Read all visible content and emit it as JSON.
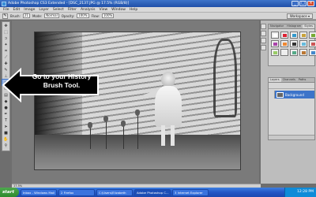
{
  "window": {
    "title": "Adobe Photoshop CS3 Extended - [DSC_2137.JPG @ 17.5% (RGB/8)]",
    "minimize": "_",
    "maximize": "□",
    "close": "×"
  },
  "menu": [
    "File",
    "Edit",
    "Image",
    "Layer",
    "Select",
    "Filter",
    "Analysis",
    "View",
    "Window",
    "Help"
  ],
  "options": {
    "brush_label": "Brush:",
    "brush_size": "21",
    "mode_label": "Mode:",
    "mode_value": "Normal",
    "opacity_label": "Opacity:",
    "opacity_value": "100%",
    "flow_label": "Flow:",
    "flow_value": "100%",
    "workspace": "Workspace ▾"
  },
  "callout": {
    "line1": "Go to your History",
    "line2": "Brush Tool."
  },
  "panels": {
    "swatch_tabs": [
      "Navigator",
      "Histogram",
      "Styles"
    ],
    "layer_tabs": [
      "Layers",
      "Channels",
      "Paths"
    ],
    "layer_name": "Background"
  },
  "status": "17.5%",
  "taskbar": {
    "start": "start",
    "tasks": [
      "Inbox - Windows Mail",
      "2 Firefox",
      "C:\\Users\\Elizabeth",
      "Adobe Photoshop C...",
      "3 Internet Explorer"
    ],
    "clock": "12:28 PM"
  },
  "colors": {
    "titlebar": "#1f4fa8",
    "taskbar": "#2356c6",
    "selected_layer": "#3d74c9"
  }
}
